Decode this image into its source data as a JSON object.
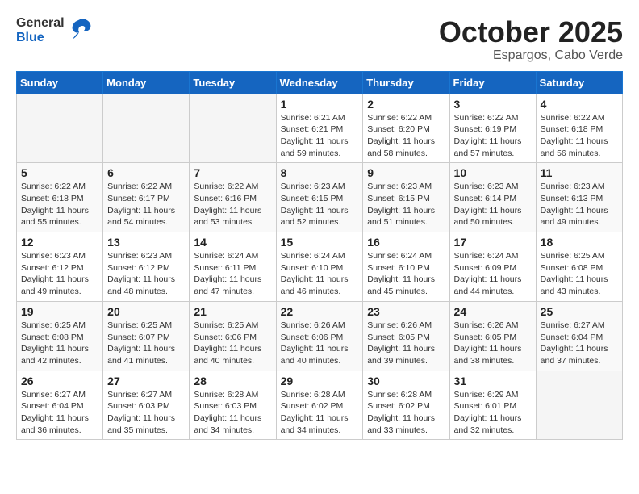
{
  "header": {
    "logo_general": "General",
    "logo_blue": "Blue",
    "month_title": "October 2025",
    "subtitle": "Espargos, Cabo Verde"
  },
  "days_of_week": [
    "Sunday",
    "Monday",
    "Tuesday",
    "Wednesday",
    "Thursday",
    "Friday",
    "Saturday"
  ],
  "weeks": [
    [
      {
        "day": "",
        "info": ""
      },
      {
        "day": "",
        "info": ""
      },
      {
        "day": "",
        "info": ""
      },
      {
        "day": "1",
        "info": "Sunrise: 6:21 AM\nSunset: 6:21 PM\nDaylight: 11 hours and 59 minutes."
      },
      {
        "day": "2",
        "info": "Sunrise: 6:22 AM\nSunset: 6:20 PM\nDaylight: 11 hours and 58 minutes."
      },
      {
        "day": "3",
        "info": "Sunrise: 6:22 AM\nSunset: 6:19 PM\nDaylight: 11 hours and 57 minutes."
      },
      {
        "day": "4",
        "info": "Sunrise: 6:22 AM\nSunset: 6:18 PM\nDaylight: 11 hours and 56 minutes."
      }
    ],
    [
      {
        "day": "5",
        "info": "Sunrise: 6:22 AM\nSunset: 6:18 PM\nDaylight: 11 hours and 55 minutes."
      },
      {
        "day": "6",
        "info": "Sunrise: 6:22 AM\nSunset: 6:17 PM\nDaylight: 11 hours and 54 minutes."
      },
      {
        "day": "7",
        "info": "Sunrise: 6:22 AM\nSunset: 6:16 PM\nDaylight: 11 hours and 53 minutes."
      },
      {
        "day": "8",
        "info": "Sunrise: 6:23 AM\nSunset: 6:15 PM\nDaylight: 11 hours and 52 minutes."
      },
      {
        "day": "9",
        "info": "Sunrise: 6:23 AM\nSunset: 6:15 PM\nDaylight: 11 hours and 51 minutes."
      },
      {
        "day": "10",
        "info": "Sunrise: 6:23 AM\nSunset: 6:14 PM\nDaylight: 11 hours and 50 minutes."
      },
      {
        "day": "11",
        "info": "Sunrise: 6:23 AM\nSunset: 6:13 PM\nDaylight: 11 hours and 49 minutes."
      }
    ],
    [
      {
        "day": "12",
        "info": "Sunrise: 6:23 AM\nSunset: 6:12 PM\nDaylight: 11 hours and 49 minutes."
      },
      {
        "day": "13",
        "info": "Sunrise: 6:23 AM\nSunset: 6:12 PM\nDaylight: 11 hours and 48 minutes."
      },
      {
        "day": "14",
        "info": "Sunrise: 6:24 AM\nSunset: 6:11 PM\nDaylight: 11 hours and 47 minutes."
      },
      {
        "day": "15",
        "info": "Sunrise: 6:24 AM\nSunset: 6:10 PM\nDaylight: 11 hours and 46 minutes."
      },
      {
        "day": "16",
        "info": "Sunrise: 6:24 AM\nSunset: 6:10 PM\nDaylight: 11 hours and 45 minutes."
      },
      {
        "day": "17",
        "info": "Sunrise: 6:24 AM\nSunset: 6:09 PM\nDaylight: 11 hours and 44 minutes."
      },
      {
        "day": "18",
        "info": "Sunrise: 6:25 AM\nSunset: 6:08 PM\nDaylight: 11 hours and 43 minutes."
      }
    ],
    [
      {
        "day": "19",
        "info": "Sunrise: 6:25 AM\nSunset: 6:08 PM\nDaylight: 11 hours and 42 minutes."
      },
      {
        "day": "20",
        "info": "Sunrise: 6:25 AM\nSunset: 6:07 PM\nDaylight: 11 hours and 41 minutes."
      },
      {
        "day": "21",
        "info": "Sunrise: 6:25 AM\nSunset: 6:06 PM\nDaylight: 11 hours and 40 minutes."
      },
      {
        "day": "22",
        "info": "Sunrise: 6:26 AM\nSunset: 6:06 PM\nDaylight: 11 hours and 40 minutes."
      },
      {
        "day": "23",
        "info": "Sunrise: 6:26 AM\nSunset: 6:05 PM\nDaylight: 11 hours and 39 minutes."
      },
      {
        "day": "24",
        "info": "Sunrise: 6:26 AM\nSunset: 6:05 PM\nDaylight: 11 hours and 38 minutes."
      },
      {
        "day": "25",
        "info": "Sunrise: 6:27 AM\nSunset: 6:04 PM\nDaylight: 11 hours and 37 minutes."
      }
    ],
    [
      {
        "day": "26",
        "info": "Sunrise: 6:27 AM\nSunset: 6:04 PM\nDaylight: 11 hours and 36 minutes."
      },
      {
        "day": "27",
        "info": "Sunrise: 6:27 AM\nSunset: 6:03 PM\nDaylight: 11 hours and 35 minutes."
      },
      {
        "day": "28",
        "info": "Sunrise: 6:28 AM\nSunset: 6:03 PM\nDaylight: 11 hours and 34 minutes."
      },
      {
        "day": "29",
        "info": "Sunrise: 6:28 AM\nSunset: 6:02 PM\nDaylight: 11 hours and 34 minutes."
      },
      {
        "day": "30",
        "info": "Sunrise: 6:28 AM\nSunset: 6:02 PM\nDaylight: 11 hours and 33 minutes."
      },
      {
        "day": "31",
        "info": "Sunrise: 6:29 AM\nSunset: 6:01 PM\nDaylight: 11 hours and 32 minutes."
      },
      {
        "day": "",
        "info": ""
      }
    ]
  ]
}
